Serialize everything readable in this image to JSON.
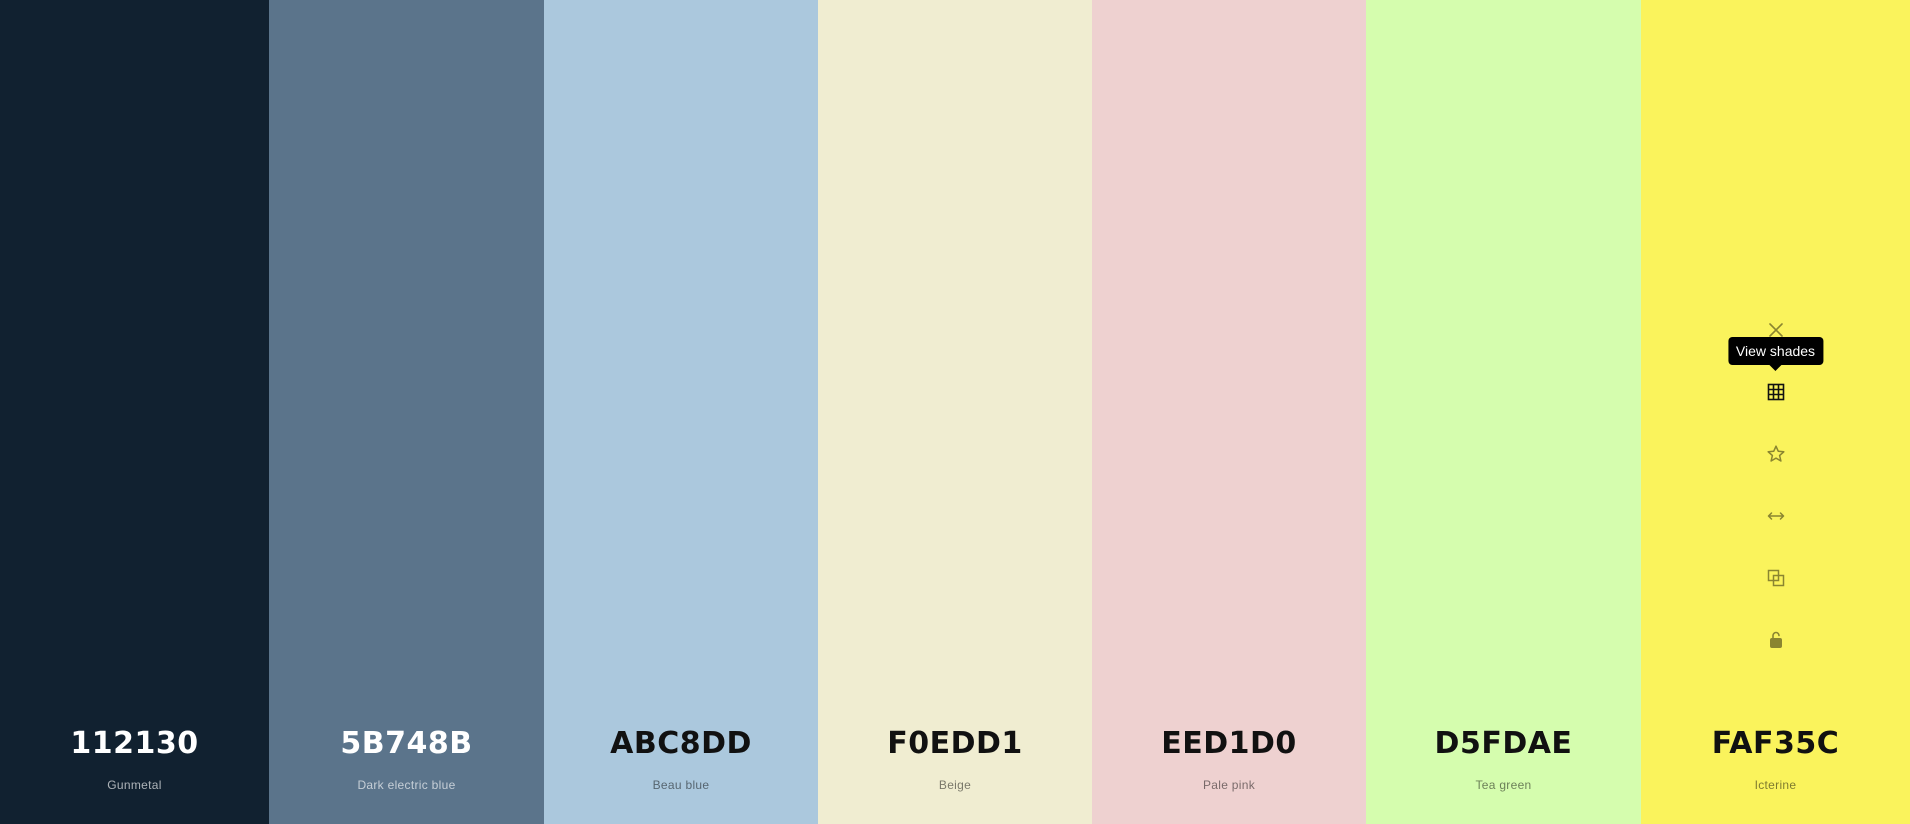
{
  "palette": {
    "colors": [
      {
        "hex": "112130",
        "name": "Gunmetal",
        "bg": "#112130"
      },
      {
        "hex": "5B748B",
        "name": "Dark electric blue",
        "bg": "#5B748B"
      },
      {
        "hex": "ABC8DD",
        "name": "Beau blue",
        "bg": "#ABC8DD"
      },
      {
        "hex": "F0EDD1",
        "name": "Beige",
        "bg": "#F0EDD1"
      },
      {
        "hex": "EED1D0",
        "name": "Pale pink",
        "bg": "#EED1D0"
      },
      {
        "hex": "D5FDAE",
        "name": "Tea green",
        "bg": "#D5FDAE"
      },
      {
        "hex": "FAF35C",
        "name": "Icterine",
        "bg": "#FAF35C"
      }
    ]
  },
  "toolbar": {
    "tooltip": "View shades",
    "icons": [
      "close-icon",
      "grid-icon",
      "star-icon",
      "arrows-horizontal-icon",
      "copy-icon",
      "unlock-icon"
    ],
    "icon_color": "#8a8530",
    "active_icon_color": "#111111"
  }
}
